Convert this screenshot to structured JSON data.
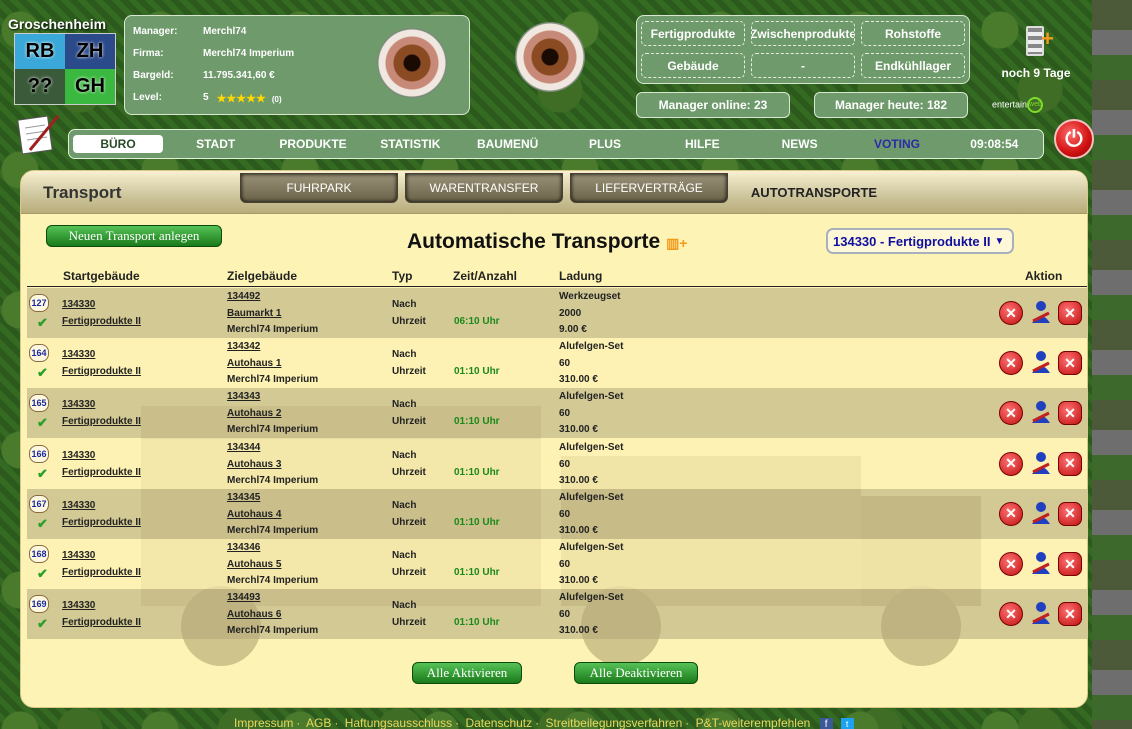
{
  "city": {
    "name": "Groschenheim",
    "districts": [
      "RB",
      "ZH",
      "??",
      "GH"
    ]
  },
  "manager": {
    "labels": {
      "manager": "Manager:",
      "firma": "Firma:",
      "bargeld": "Bargeld:",
      "level": "Level:"
    },
    "manager": "Merchl74",
    "firma": "Merchl74 Imperium",
    "bargeld": "11.795.341,60 €",
    "level": "5",
    "stars": "★★★★★",
    "level_small": "(0)"
  },
  "resources": [
    "Fertigprodukte",
    "Zwischenprodukte",
    "Rohstoffe",
    "Gebäude",
    "-",
    "Endkühllager"
  ],
  "stats": {
    "online_label": "Manager online:",
    "online": "23",
    "today_label": "Manager heute:",
    "today": "182"
  },
  "premium": {
    "text": "noch 9 Tage"
  },
  "entertain": {
    "text": "entertain",
    "badge": "web"
  },
  "nav": {
    "items": [
      "BÜRO",
      "STADT",
      "PRODUKTE",
      "STATISTIK",
      "BAUMENÜ",
      "PLUS",
      "HILFE",
      "NEWS",
      "VOTING"
    ],
    "time": "09:08:54"
  },
  "main": {
    "title": "Transport",
    "tabs": [
      "FUHRPARK",
      "WARENTRANSFER",
      "LIEFERVERTRÄGE",
      "AUTOTRANSPORTE"
    ],
    "new_button": "Neuen Transport anlegen",
    "page_title": "Automatische Transporte",
    "selector": "134330 - Fertigprodukte II",
    "headers": [
      "Startgebäude",
      "Zielgebäude",
      "Typ",
      "Zeit/Anzahl",
      "Ladung",
      "Aktion"
    ],
    "rows": [
      {
        "nr": "127",
        "start_id": "134330",
        "start_name": "Fertigprodukte II",
        "ziel_id": "134492",
        "ziel_name": "Baumarkt 1",
        "ziel_owner": "Merchl74 Imperium",
        "typ1": "Nach",
        "typ2": "Uhrzeit",
        "zeit": "06:10 Uhr",
        "ladung": "Werkzeugset",
        "menge": "2000",
        "preis": "9.00 €"
      },
      {
        "nr": "164",
        "start_id": "134330",
        "start_name": "Fertigprodukte II",
        "ziel_id": "134342",
        "ziel_name": "Autohaus 1",
        "ziel_owner": "Merchl74 Imperium",
        "typ1": "Nach",
        "typ2": "Uhrzeit",
        "zeit": "01:10 Uhr",
        "ladung": "Alufelgen-Set",
        "menge": "60",
        "preis": "310.00 €"
      },
      {
        "nr": "165",
        "start_id": "134330",
        "start_name": "Fertigprodukte II",
        "ziel_id": "134343",
        "ziel_name": "Autohaus 2",
        "ziel_owner": "Merchl74 Imperium",
        "typ1": "Nach",
        "typ2": "Uhrzeit",
        "zeit": "01:10 Uhr",
        "ladung": "Alufelgen-Set",
        "menge": "60",
        "preis": "310.00 €"
      },
      {
        "nr": "166",
        "start_id": "134330",
        "start_name": "Fertigprodukte II",
        "ziel_id": "134344",
        "ziel_name": "Autohaus 3",
        "ziel_owner": "Merchl74 Imperium",
        "typ1": "Nach",
        "typ2": "Uhrzeit",
        "zeit": "01:10 Uhr",
        "ladung": "Alufelgen-Set",
        "menge": "60",
        "preis": "310.00 €"
      },
      {
        "nr": "167",
        "start_id": "134330",
        "start_name": "Fertigprodukte II",
        "ziel_id": "134345",
        "ziel_name": "Autohaus 4",
        "ziel_owner": "Merchl74 Imperium",
        "typ1": "Nach",
        "typ2": "Uhrzeit",
        "zeit": "01:10 Uhr",
        "ladung": "Alufelgen-Set",
        "menge": "60",
        "preis": "310.00 €"
      },
      {
        "nr": "168",
        "start_id": "134330",
        "start_name": "Fertigprodukte II",
        "ziel_id": "134346",
        "ziel_name": "Autohaus 5",
        "ziel_owner": "Merchl74 Imperium",
        "typ1": "Nach",
        "typ2": "Uhrzeit",
        "zeit": "01:10 Uhr",
        "ladung": "Alufelgen-Set",
        "menge": "60",
        "preis": "310.00 €"
      },
      {
        "nr": "169",
        "start_id": "134330",
        "start_name": "Fertigprodukte II",
        "ziel_id": "134493",
        "ziel_name": "Autohaus 6",
        "ziel_owner": "Merchl74 Imperium",
        "typ1": "Nach",
        "typ2": "Uhrzeit",
        "zeit": "01:10 Uhr",
        "ladung": "Alufelgen-Set",
        "menge": "60",
        "preis": "310.00 €"
      }
    ],
    "activate_all": "Alle Aktivieren",
    "deactivate_all": "Alle Deaktivieren"
  },
  "footer": [
    "Impressum",
    "AGB",
    "Haftungsausschluss",
    "Datenschutz",
    "Streitbeilegungsverfahren",
    "P&T-weiterempfehlen"
  ],
  "social": {
    "facebook": "f",
    "twitter": "t"
  }
}
